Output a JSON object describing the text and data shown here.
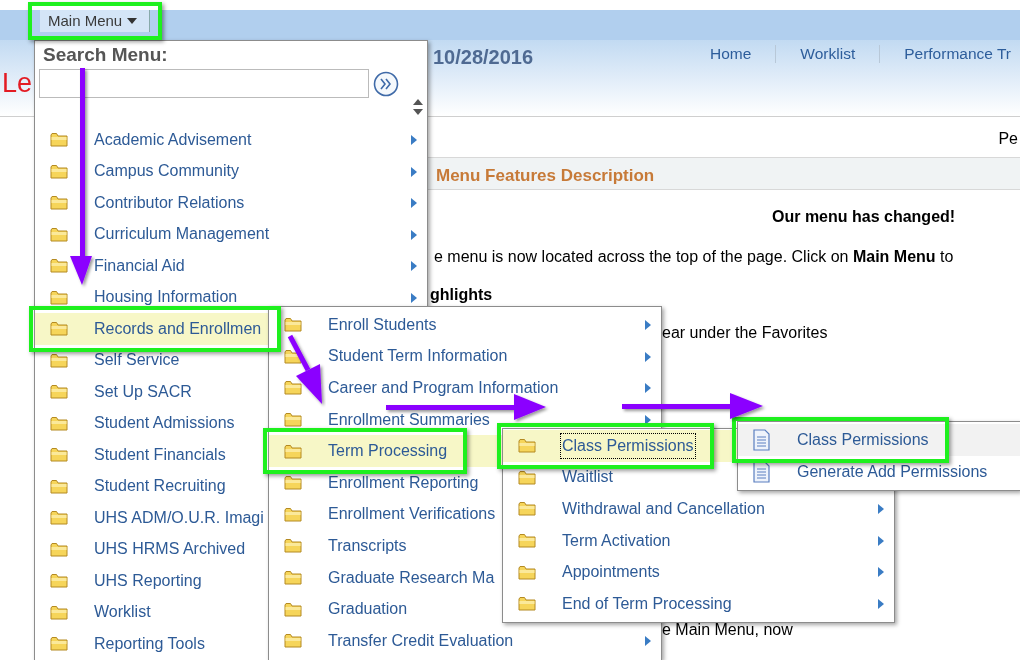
{
  "header": {
    "main_menu": {
      "label": "Main Menu",
      "annotated": true
    },
    "logo_fragment": "Le",
    "date": "10/28/2016",
    "nav": [
      "Home",
      "Worklist",
      "Performance Tr"
    ]
  },
  "page": {
    "corner_text": "Pe",
    "section_title": "Menu Features Description",
    "heading": "Our menu has changed!",
    "paragraph": "e menu is now located across the top of the page. Click on **Main Menu** to",
    "subheading": "ghlights",
    "line_1": "ear under the Favorites",
    "line_2": "e Main Menu, now"
  },
  "menus": [
    {
      "search_label": "Search Menu:",
      "items": [
        {
          "label": "Academic Advisement",
          "kind": "folder",
          "submenu": true,
          "selected": false,
          "focused": false
        },
        {
          "label": "Campus Community",
          "kind": "folder",
          "submenu": true,
          "selected": false,
          "focused": false
        },
        {
          "label": "Contributor Relations",
          "kind": "folder",
          "submenu": true,
          "selected": false,
          "focused": false
        },
        {
          "label": "Curriculum Management",
          "kind": "folder",
          "submenu": true,
          "selected": false,
          "focused": false
        },
        {
          "label": "Financial Aid",
          "kind": "folder",
          "submenu": true,
          "selected": false,
          "focused": false
        },
        {
          "label": "Housing Information",
          "kind": "folder",
          "submenu": true,
          "selected": false,
          "focused": false
        },
        {
          "label": "Records and Enrollmen",
          "kind": "folder",
          "selected": true,
          "focused": false,
          "annotated": true
        },
        {
          "label": "Self Service",
          "kind": "folder",
          "selected": false,
          "focused": false
        },
        {
          "label": "Set Up SACR",
          "kind": "folder",
          "selected": false,
          "focused": false
        },
        {
          "label": "Student Admissions",
          "kind": "folder",
          "selected": false,
          "focused": false
        },
        {
          "label": "Student Financials",
          "kind": "folder",
          "selected": false,
          "focused": false
        },
        {
          "label": "Student Recruiting",
          "kind": "folder",
          "selected": false,
          "focused": false
        },
        {
          "label": "UHS ADM/O.U.R. Imagi",
          "kind": "folder",
          "selected": false,
          "focused": false
        },
        {
          "label": "UHS HRMS Archived",
          "kind": "folder",
          "selected": false,
          "focused": false
        },
        {
          "label": "UHS Reporting",
          "kind": "folder",
          "selected": false,
          "focused": false
        },
        {
          "label": "Worklist",
          "kind": "folder",
          "selected": false,
          "focused": false
        },
        {
          "label": "Reporting Tools",
          "kind": "folder",
          "selected": false,
          "focused": false
        }
      ]
    },
    {
      "items": [
        {
          "label": "Enroll Students",
          "kind": "folder",
          "submenu": true,
          "selected": false,
          "focused": false
        },
        {
          "label": "Student Term Information",
          "kind": "folder",
          "submenu": true,
          "selected": false,
          "focused": false
        },
        {
          "label": "Career and Program Information",
          "kind": "folder",
          "submenu": true,
          "selected": false,
          "focused": false
        },
        {
          "label": "Enrollment Summaries",
          "kind": "folder",
          "submenu": true,
          "selected": false,
          "focused": false
        },
        {
          "label": "Term Processing",
          "kind": "folder",
          "selected": true,
          "focused": false,
          "annotated": true
        },
        {
          "label": "Enrollment Reporting",
          "kind": "folder",
          "selected": false,
          "focused": false
        },
        {
          "label": "Enrollment Verifications",
          "kind": "folder",
          "selected": false,
          "focused": false
        },
        {
          "label": "Transcripts",
          "kind": "folder",
          "selected": false,
          "focused": false
        },
        {
          "label": "Graduate Research Ma",
          "kind": "folder",
          "selected": false,
          "focused": false
        },
        {
          "label": "Graduation",
          "kind": "folder",
          "selected": false,
          "focused": false
        },
        {
          "label": "Transfer Credit Evaluation",
          "kind": "folder",
          "submenu": true,
          "selected": false,
          "focused": false
        }
      ]
    },
    {
      "items": [
        {
          "label": "Class Permissions",
          "kind": "folder",
          "selected": true,
          "focused": true,
          "annotated": true
        },
        {
          "label": "Waitlist",
          "kind": "folder",
          "selected": false,
          "focused": false
        },
        {
          "label": "Withdrawal and Cancellation",
          "kind": "folder",
          "submenu": true,
          "selected": false,
          "focused": false
        },
        {
          "label": "Term Activation",
          "kind": "folder",
          "submenu": true,
          "selected": false,
          "focused": false
        },
        {
          "label": "Appointments",
          "kind": "folder",
          "submenu": true,
          "selected": false,
          "focused": false
        },
        {
          "label": "End of Term Processing",
          "kind": "folder",
          "submenu": true,
          "selected": false,
          "focused": false
        }
      ]
    },
    {
      "items": [
        {
          "label": "Class Permissions",
          "kind": "document",
          "hovered": true,
          "annotated": true
        },
        {
          "label": "Generate Add Permissions",
          "kind": "document",
          "hovered": false
        }
      ]
    }
  ]
}
